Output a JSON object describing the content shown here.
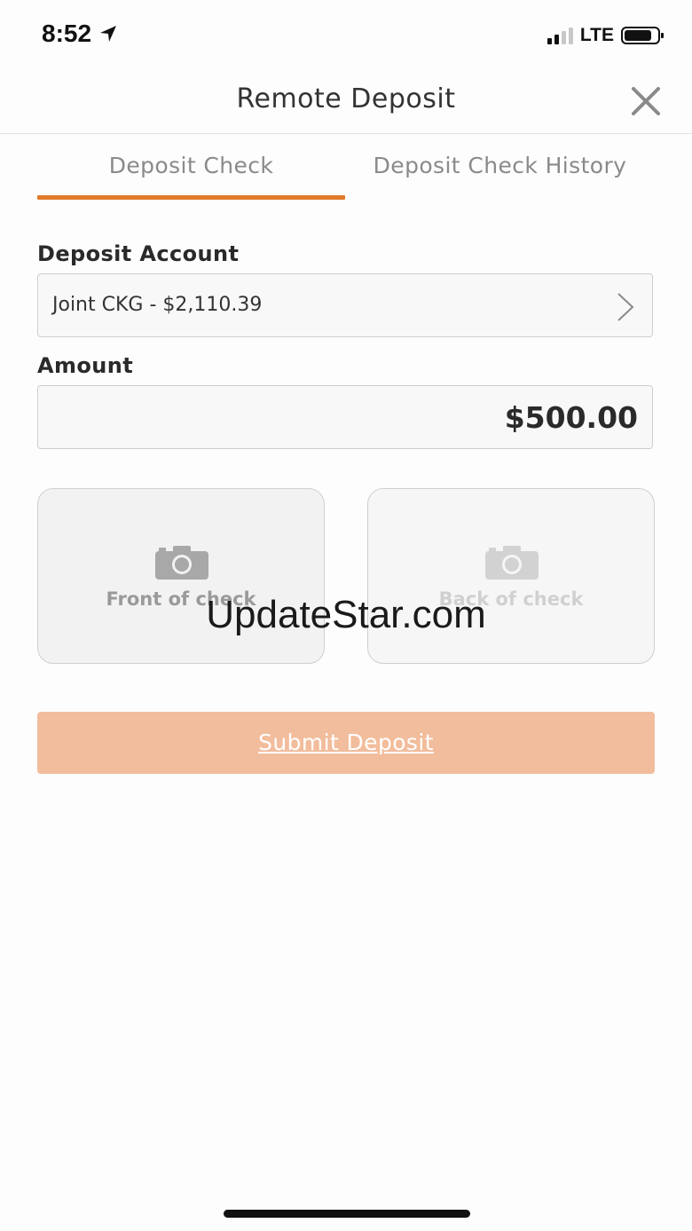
{
  "status_bar": {
    "time": "8:52",
    "network": "LTE",
    "icons": [
      "location-arrow-icon",
      "signal-icon",
      "battery-icon"
    ]
  },
  "header": {
    "title": "Remote Deposit",
    "close_icon": "close-icon"
  },
  "tabs": [
    {
      "label": "Deposit Check",
      "active": true
    },
    {
      "label": "Deposit Check History",
      "active": false
    }
  ],
  "form": {
    "deposit_account": {
      "label": "Deposit Account",
      "value": "Joint CKG - $2,110.39",
      "icon": "chevron-right-icon"
    },
    "amount": {
      "label": "Amount",
      "value": "$500.00"
    }
  },
  "check_images": {
    "front": {
      "label": "Front of check",
      "icon": "camera-icon"
    },
    "back": {
      "label": "Back of check",
      "icon": "camera-icon"
    }
  },
  "submit": {
    "label": "Submit Deposit"
  },
  "watermark": "UpdateStar.com",
  "colors": {
    "accent": "#e07a2a",
    "submit_bg": "#f2bd9c",
    "tab_inactive": "#8a8a8a"
  }
}
